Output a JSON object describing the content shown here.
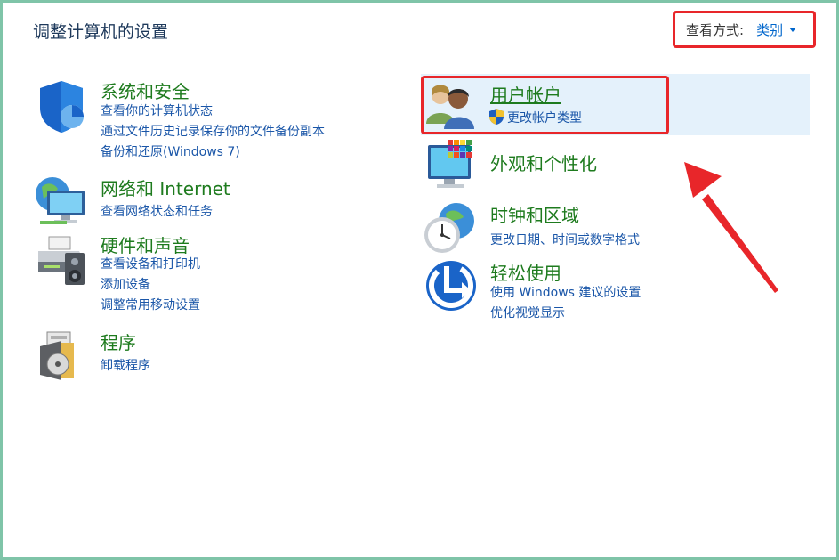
{
  "header": {
    "title": "调整计算机的设置",
    "view_label": "查看方式:",
    "view_value": "类别"
  },
  "categories": [
    {
      "title": "系统和安全",
      "icon": "shield-icon",
      "links": [
        "查看你的计算机状态",
        "通过文件历史记录保存你的文件备份副本",
        "备份和还原(Windows 7)"
      ]
    },
    {
      "title": "网络和 Internet",
      "icon": "network-icon",
      "links": [
        "查看网络状态和任务"
      ]
    },
    {
      "title": "硬件和声音",
      "icon": "printer-icon",
      "links": [
        "查看设备和打印机",
        "添加设备",
        "调整常用移动设置"
      ]
    },
    {
      "title": "程序",
      "icon": "programs-icon",
      "links": [
        "卸载程序"
      ]
    },
    {
      "title": "用户帐户",
      "icon": "users-icon",
      "links": [
        "更改帐户类型"
      ]
    },
    {
      "title": "外观和个性化",
      "icon": "monitor-icon",
      "links": []
    },
    {
      "title": "时钟和区域",
      "icon": "clock-icon",
      "links": [
        "更改日期、时间或数字格式"
      ]
    },
    {
      "title": "轻松使用",
      "icon": "accessibility-icon",
      "links": [
        "使用 Windows 建议的设置",
        "优化视觉显示"
      ]
    }
  ],
  "colors": {
    "title_text": "#1e395b",
    "category_title": "#1e7b1e",
    "link": "#1a56a8",
    "highlight_background": "#e4f1fb",
    "annotation_red": "#e8262a",
    "window_border": "#7fc4a8"
  }
}
